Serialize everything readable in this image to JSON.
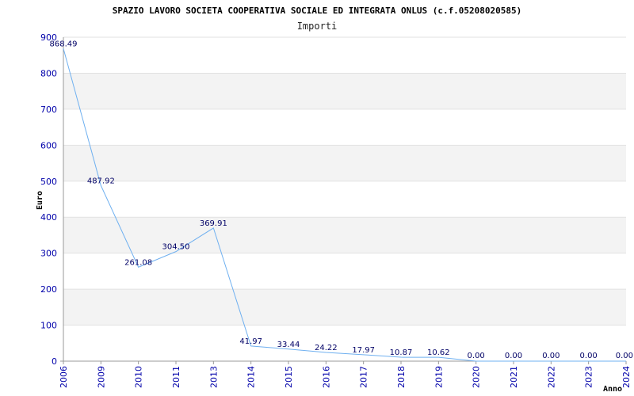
{
  "chart_data": {
    "type": "line",
    "title": "SPAZIO LAVORO SOCIETA COOPERATIVA SOCIALE ED INTEGRATA ONLUS (c.f.05208020585)",
    "subtitle": "Importi",
    "xlabel": "Anno",
    "ylabel": "Euro",
    "ylim": [
      0,
      900
    ],
    "yticks": [
      "0",
      "100",
      "200",
      "300",
      "400",
      "500",
      "600",
      "700",
      "800",
      "900"
    ],
    "categories": [
      "2006",
      "2009",
      "2010",
      "2011",
      "2013",
      "2014",
      "2015",
      "2016",
      "2017",
      "2018",
      "2019",
      "2020",
      "2021",
      "2022",
      "2023",
      "2024"
    ],
    "series": [
      {
        "values": [
          868.49,
          487.92,
          261.08,
          304.5,
          369.91,
          41.97,
          33.44,
          24.22,
          17.97,
          10.87,
          10.62,
          0.0,
          0.0,
          0.0,
          0.0,
          0.0
        ],
        "labels": [
          "868.49",
          "487.92",
          "261.08",
          "304.50",
          "369.91",
          "41.97",
          "33.44",
          "24.22",
          "17.97",
          "10.87",
          "10.62",
          "0.00",
          "0.00",
          "0.00",
          "0.00",
          "0.00"
        ]
      }
    ],
    "grid": true,
    "colors": {
      "line": "#6fb0f0",
      "band": "#f3f3f3",
      "gridline": "#e2e2e2",
      "tick": "#0000aa",
      "label": "#000066"
    }
  }
}
